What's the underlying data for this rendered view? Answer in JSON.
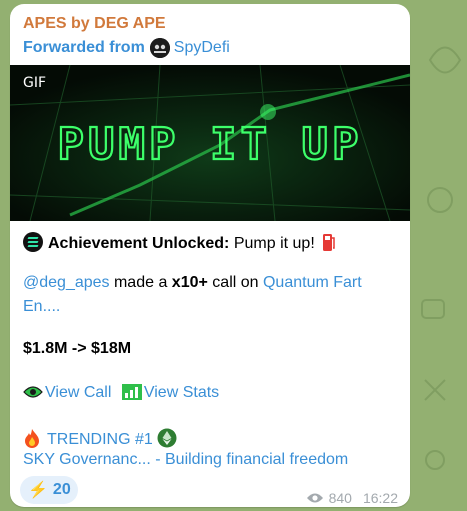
{
  "message": {
    "sender": "APES by DEG APE",
    "forwarded_prefix": "Forwarded from",
    "forwarded_channel": "SpyDefi",
    "gif_badge": "GIF",
    "gif_text": "PUMP IT UP",
    "achievement_label": "Achievement Unlocked:",
    "achievement_value": " Pump it up!",
    "mention": "@deg_apes",
    "made_a": " made a ",
    "multiplier": "x10+",
    "call_on": " call on ",
    "token_link_1": "Quantum Fart",
    "token_link_2": "En....",
    "price_change": "$1.8M -> $18M",
    "view_call": "View Call",
    "view_stats": "View Stats",
    "trending": "TRENDING #1",
    "trending_token": "SKY Governanc... - Building financial freedom"
  },
  "reaction": {
    "emoji": "⚡",
    "count": "20"
  },
  "meta": {
    "views": "840",
    "time": "16:22"
  },
  "colors": {
    "sender": "#d1793b",
    "link": "#3a8fd6",
    "wallpaper": "#93b071",
    "gif_neon": "#3dff6a"
  },
  "icons": [
    "solana-icon",
    "fuel-pump-icon",
    "eye-icon",
    "chart-icon",
    "fire-icon",
    "ethereum-icon",
    "lightning-icon"
  ]
}
